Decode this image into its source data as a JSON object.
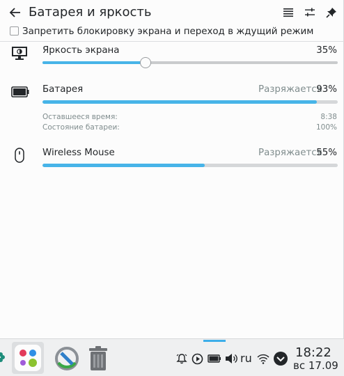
{
  "header": {
    "title": "Батарея и яркость",
    "back_icon": "arrow-left-icon",
    "menu_icon": "hamburger-menu-icon",
    "settings_icon": "sliders-icon",
    "pin_icon": "pin-icon"
  },
  "inhibit": {
    "label": "Запретить блокировку экрана и переход в ждущий режим",
    "checked": false
  },
  "brightness": {
    "label": "Яркость экрана",
    "percent_text": "35%",
    "value": 0.35,
    "icon": "monitor-brightness-icon"
  },
  "battery": {
    "label": "Батарея",
    "status": "Разряжается",
    "percent_text": "93%",
    "value": 0.93,
    "icon": "battery-icon",
    "details": [
      {
        "label": "Оставшееся время:",
        "value": "8:38"
      },
      {
        "label": "Состояние батареи:",
        "value": "100%"
      }
    ]
  },
  "mouse": {
    "label": "Wireless Mouse",
    "status": "Разряжается",
    "percent_text": "55%",
    "value": 0.55,
    "icon": "mouse-icon"
  },
  "taskbar": {
    "tray": {
      "language": "ru"
    },
    "clock": {
      "time": "18:22",
      "date": "вс 17.09"
    }
  },
  "colors": {
    "accent": "#47b4e8",
    "text": "#232629",
    "muted": "#7f8c8d"
  }
}
